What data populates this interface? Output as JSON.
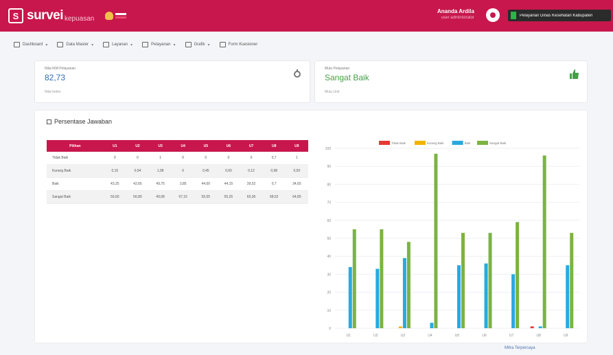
{
  "header": {
    "logo_text": "survei",
    "logo_sub": "kepuasan",
    "user_name": "Ananda Ardila",
    "user_sub": "user administrator",
    "org_name": "Pelayanan Dinas Kesehatan Kabupaten"
  },
  "nav": [
    {
      "icon": "dashboard-icon",
      "label": "Dashboard",
      "caret": true
    },
    {
      "icon": "master-data-icon",
      "label": "Data Master",
      "caret": true
    },
    {
      "icon": "layanan-icon",
      "label": "Layanan",
      "caret": true
    },
    {
      "icon": "pelayanan-icon",
      "label": "Pelayanan",
      "caret": true
    },
    {
      "icon": "grafik-icon",
      "label": "Grafik",
      "caret": true
    },
    {
      "icon": "kuesioner-icon",
      "label": "Form Kuesioner",
      "caret": false
    }
  ],
  "cards": {
    "ikm": {
      "label": "Nilai IKM Pelayanan",
      "value": "82,73",
      "caption": "Nilai Index",
      "icon": "chart-icon"
    },
    "mutu": {
      "label": "Mutu Pelayanan",
      "value": "Sangat Baik",
      "caption": "Mutu Unit",
      "icon": "thumb-icon"
    }
  },
  "panel_title": "Persentase Jawaban",
  "table": {
    "columns": [
      "Pilihan",
      "U1",
      "U2",
      "U3",
      "U4",
      "U5",
      "U6",
      "U7",
      "U8",
      "U9"
    ],
    "rows": [
      [
        "Tidak Baik",
        "0",
        "0",
        "1",
        "0",
        "0",
        "0",
        "0",
        "0,7",
        "1"
      ],
      [
        "Kurang Baik",
        "0,15",
        "0,54",
        "1,08",
        "0",
        "0,45",
        "0,60",
        "0,12",
        "0,98",
        "0,50"
      ],
      [
        "Baik",
        "43,25",
        "42,65",
        "49,75",
        "3,85",
        "44,00",
        "44,15",
        "39,52",
        "0,7",
        "34,65"
      ],
      [
        "Sangat Baik",
        "56,60",
        "56,80",
        "49,08",
        "97,15",
        "55,55",
        "55,25",
        "60,36",
        "98,52",
        "64,85"
      ]
    ]
  },
  "chart_data": {
    "type": "bar",
    "categories": [
      "U1",
      "U2",
      "U3",
      "U4",
      "U5",
      "U6",
      "U7",
      "U8",
      "U9"
    ],
    "series": [
      {
        "name": "Tidak Baik",
        "color": "#e53935",
        "values": [
          0,
          0,
          0,
          0,
          0,
          0,
          0,
          1,
          0
        ]
      },
      {
        "name": "Kurang Baik",
        "color": "#f4b400",
        "values": [
          0,
          0,
          1,
          0,
          0,
          0,
          0,
          0,
          0
        ]
      },
      {
        "name": "Baik",
        "color": "#29a9df",
        "values": [
          34,
          33,
          39,
          3,
          35,
          36,
          30,
          1,
          35
        ]
      },
      {
        "name": "Sangat Baik",
        "color": "#7cb342",
        "values": [
          55,
          55,
          48,
          97,
          53,
          53,
          59,
          96,
          53
        ]
      }
    ],
    "ylim": [
      0,
      100
    ],
    "ticks": [
      "0",
      "10",
      "20",
      "30",
      "40",
      "50",
      "60",
      "70",
      "80",
      "90",
      "100"
    ],
    "legend_position": "top"
  },
  "footer": "Mitra Terpercaya"
}
